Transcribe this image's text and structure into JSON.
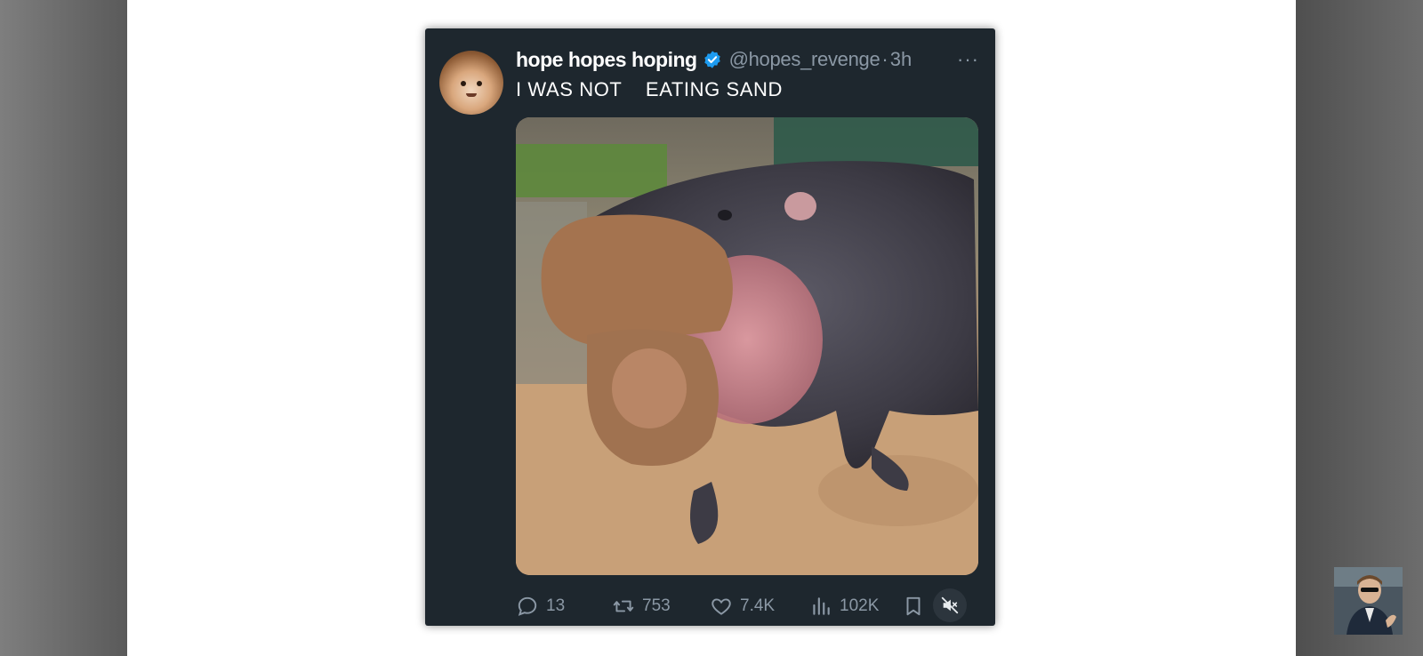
{
  "tweet": {
    "display_name": "hope hopes hoping",
    "handle": "@hopes_revenge",
    "separator": "·",
    "time": "3h",
    "more": "···",
    "text": "I WAS NOT    EATING SAND",
    "verified_color": "#1d9bf0",
    "media_alt_icon": "video-player",
    "actions": {
      "replies": "13",
      "reposts": "753",
      "likes": "7.4K",
      "views": "102K"
    }
  },
  "icons": {
    "reply": "reply-icon",
    "repost": "repost-icon",
    "like": "heart-icon",
    "views": "views-chart-icon",
    "bookmark": "bookmark-icon",
    "mute": "muted-speaker-icon"
  },
  "colors": {
    "card_background": "#1e272e",
    "muted_text": "#8b98a5",
    "side_panels": "#5a5a5a"
  }
}
